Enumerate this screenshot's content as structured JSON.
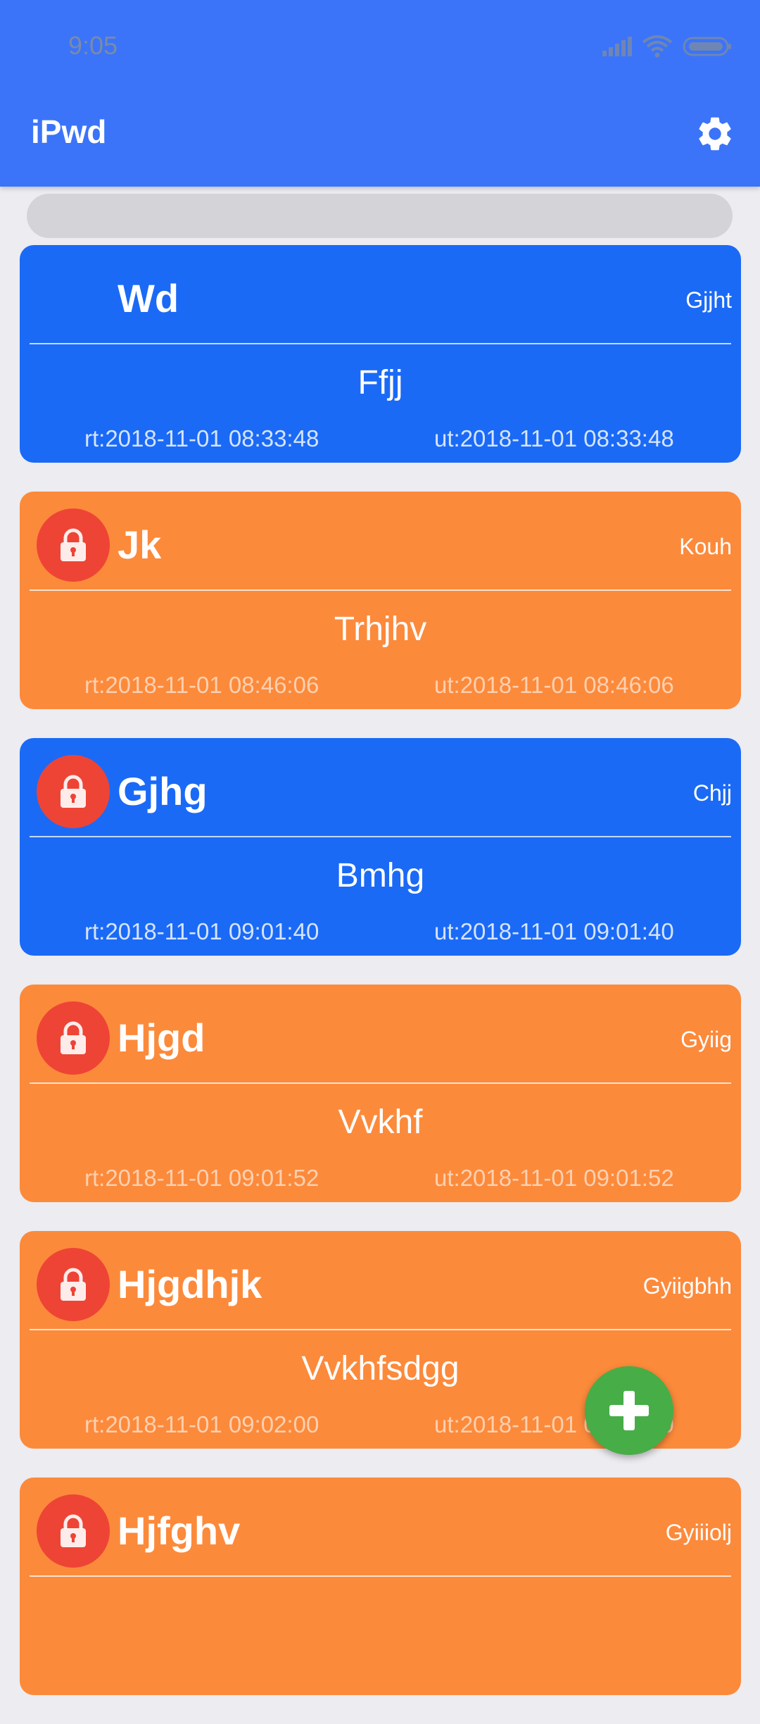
{
  "status_bar": {
    "time": "9:05",
    "icons": [
      "signal-icon",
      "wifi-icon",
      "battery-icon"
    ]
  },
  "app_bar": {
    "title": "iPwd",
    "settings_icon": "gear-icon",
    "color": "#3b74f8"
  },
  "search": {
    "placeholder": ""
  },
  "colors": {
    "blue_card": "#1a6af6",
    "orange_card": "#fc8a3b",
    "lock_badge": "#ee4435",
    "fab": "#47ad47"
  },
  "entries": [
    {
      "title": "Wd",
      "tag": "Gjjht",
      "subtitle": "Ffjj",
      "rt": "rt:2018-11-01 08:33:48",
      "ut": "ut:2018-11-01 08:33:48",
      "color": "blue",
      "locked": false
    },
    {
      "title": "Jk",
      "tag": "Kouh",
      "subtitle": "Trhjhv",
      "rt": "rt:2018-11-01 08:46:06",
      "ut": "ut:2018-11-01 08:46:06",
      "color": "orange",
      "locked": true
    },
    {
      "title": "Gjhg",
      "tag": "Chjj",
      "subtitle": "Bmhg",
      "rt": "rt:2018-11-01 09:01:40",
      "ut": "ut:2018-11-01 09:01:40",
      "color": "blue",
      "locked": true
    },
    {
      "title": "Hjgd",
      "tag": "Gyiig",
      "subtitle": "Vvkhf",
      "rt": "rt:2018-11-01 09:01:52",
      "ut": "ut:2018-11-01 09:01:52",
      "color": "orange",
      "locked": true
    },
    {
      "title": "Hjgdhjk",
      "tag": "Gyiigbhh",
      "subtitle": "Vvkhfsdgg",
      "rt": "rt:2018-11-01 09:02:00",
      "ut": "ut:2018-11-01 09:02:00",
      "color": "orange",
      "locked": true
    },
    {
      "title": "Hjfghv",
      "tag": "Gyiiiolj",
      "subtitle": "",
      "rt": "",
      "ut": "",
      "color": "orange",
      "locked": true
    }
  ],
  "fab": {
    "icon": "plus-icon"
  }
}
